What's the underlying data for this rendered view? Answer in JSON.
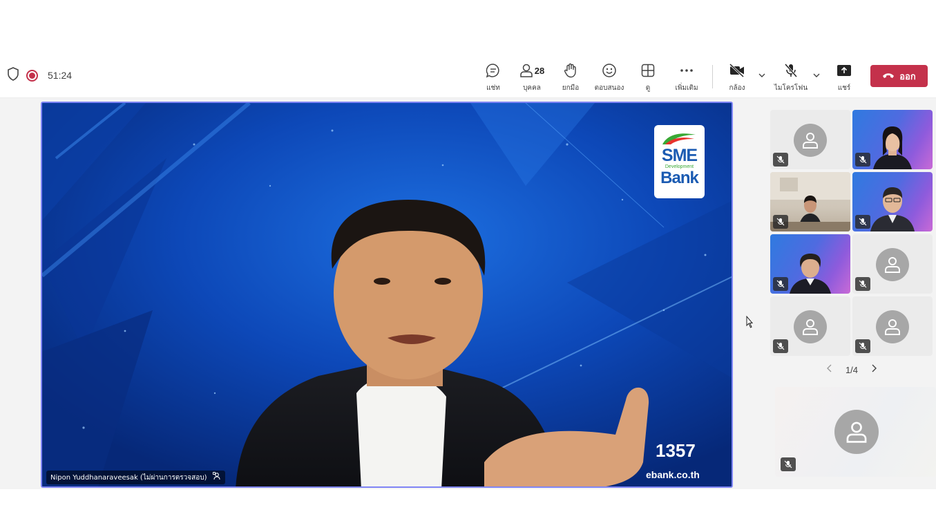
{
  "call": {
    "timer": "51:24"
  },
  "toolbar": {
    "chat_label": "แช่ท",
    "people_label": "บุคคล",
    "people_count": "28",
    "raise_hand_label": "ยกมือ",
    "react_label": "ตอบสนอง",
    "view_label": "ดู",
    "more_label": "เพิ่มเติม",
    "camera_label": "กล้อง",
    "mic_label": "ไมโครโฟน",
    "share_label": "แชร์",
    "leave_label": "ออก"
  },
  "main_video": {
    "speaker_name": "Nipon Yuddhanaraveesak (ไม่ผ่านการตรวจสอบ)",
    "logo": {
      "line1": "SME",
      "line2": "Development",
      "line3": "Bank"
    },
    "hotline": "1357",
    "website": "ebank.co.th"
  },
  "gallery": {
    "page_indicator": "1/4",
    "tiles": [
      {
        "kind": "avatar",
        "muted": true
      },
      {
        "kind": "video-woman",
        "muted": true
      },
      {
        "kind": "video-room",
        "muted": true
      },
      {
        "kind": "video-man",
        "muted": true
      },
      {
        "kind": "video-woman",
        "muted": true
      },
      {
        "kind": "avatar",
        "muted": true
      },
      {
        "kind": "avatar",
        "muted": true
      },
      {
        "kind": "avatar",
        "muted": true
      }
    ]
  },
  "colors": {
    "leave_red": "#c4314b",
    "active_speaker_border": "#7f85f5",
    "video_background": "#0a2f8a"
  }
}
